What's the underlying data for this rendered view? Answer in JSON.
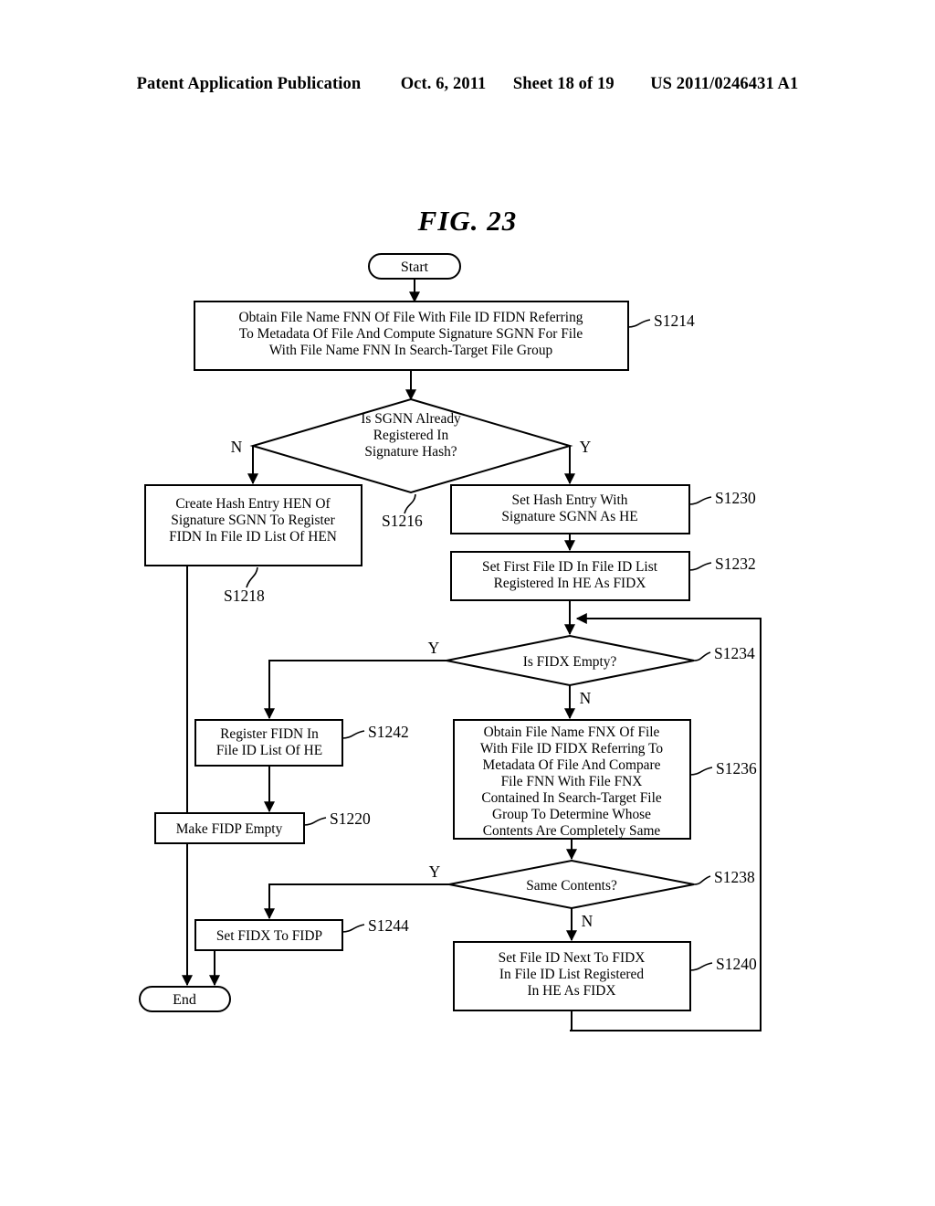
{
  "header": {
    "publication": "Patent Application Publication",
    "date": "Oct. 6, 2011",
    "sheet": "Sheet 18 of 19",
    "docnum": "US 2011/0246431 A1"
  },
  "figure": {
    "title": "FIG.  23"
  },
  "flowchart": {
    "start_label": "Start",
    "end_label": "End",
    "nodes": {
      "s1214": {
        "id": "S1214",
        "lines": [
          "Obtain File Name FNN Of File With File ID FIDN Referring",
          "To Metadata Of File And Compute Signature SGNN For File",
          "With File Name FNN In Search-Target File Group"
        ]
      },
      "s1216": {
        "id": "S1216",
        "lines": [
          "Is SGNN Already",
          "Registered In",
          "Signature Hash?"
        ],
        "branch_no": "N",
        "branch_yes": "Y"
      },
      "s1218": {
        "id": "S1218",
        "lines": [
          "Create Hash Entry HEN Of",
          "Signature SGNN To Register",
          "FIDN In File ID List Of HEN"
        ]
      },
      "s1230": {
        "id": "S1230",
        "lines": [
          "Set Hash Entry With",
          "Signature SGNN As HE"
        ]
      },
      "s1232": {
        "id": "S1232",
        "lines": [
          "Set First File ID In File ID List",
          "Registered In HE As FIDX"
        ]
      },
      "s1234": {
        "id": "S1234",
        "lines": [
          "Is FIDX Empty?"
        ],
        "branch_yes": "Y",
        "branch_no": "N"
      },
      "s1236": {
        "id": "S1236",
        "lines": [
          "Obtain File Name FNX Of File",
          "With File ID FIDX Referring To",
          "Metadata Of File And Compare",
          "File FNN With File FNX",
          "Contained In Search-Target File",
          "Group To Determine Whose",
          "Contents Are Completely Same"
        ]
      },
      "s1238": {
        "id": "S1238",
        "lines": [
          "Same Contents?"
        ],
        "branch_yes": "Y",
        "branch_no": "N"
      },
      "s1240": {
        "id": "S1240",
        "lines": [
          "Set File ID Next To FIDX",
          "In File ID List Registered",
          "In HE As FIDX"
        ]
      },
      "s1242": {
        "id": "S1242",
        "lines": [
          "Register FIDN In",
          "File ID List Of HE"
        ]
      },
      "s1220": {
        "id": "S1220",
        "lines": [
          "Make FIDP Empty"
        ]
      },
      "s1244": {
        "id": "S1244",
        "lines": [
          "Set FIDX To FIDP"
        ]
      }
    }
  },
  "colors": {
    "ink": "#000000",
    "paper": "#ffffff"
  }
}
